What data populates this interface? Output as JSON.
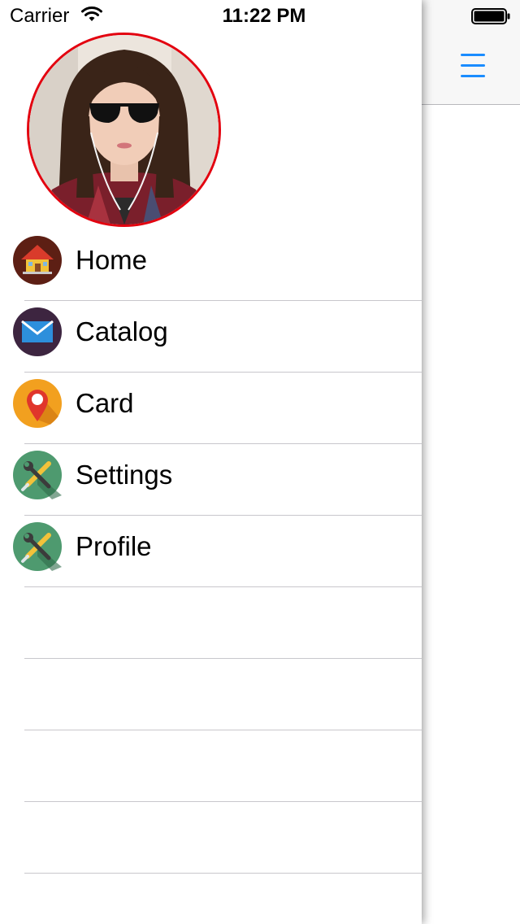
{
  "status_bar": {
    "carrier": "Carrier",
    "time": "11:22 PM",
    "signal_icon": "wifi-icon",
    "battery_icon": "battery-icon"
  },
  "nav_bar": {
    "menu_icon": "hamburger-menu-icon",
    "accent_color": "#1a8cff"
  },
  "profile": {
    "avatar_icon": "profile-photo",
    "avatar_border_color": "#e3000f"
  },
  "menu": {
    "items": [
      {
        "label": "Home",
        "icon": "house-icon"
      },
      {
        "label": "Catalog",
        "icon": "envelope-icon"
      },
      {
        "label": "Card",
        "icon": "map-pin-icon"
      },
      {
        "label": "Settings",
        "icon": "wrench-screwdriver-icon"
      },
      {
        "label": "Profile",
        "icon": "wrench-screwdriver-icon"
      }
    ],
    "empty_rows": 4
  }
}
